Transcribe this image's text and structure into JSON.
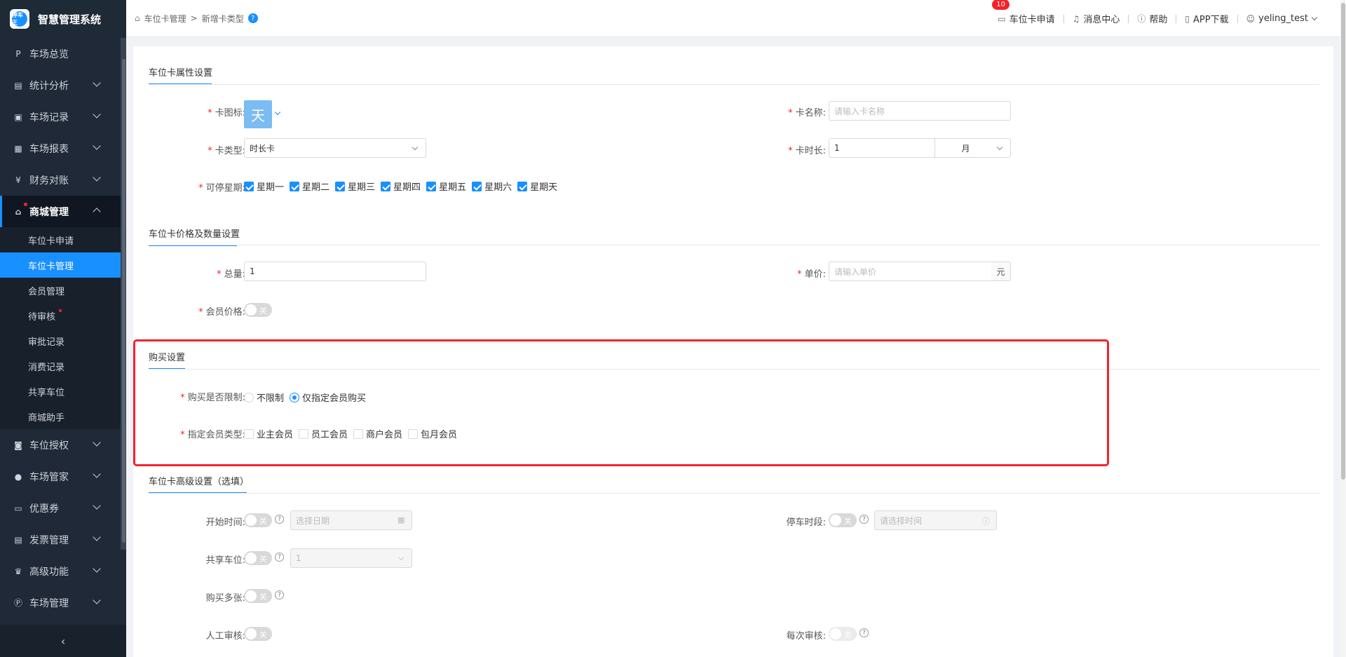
{
  "app": {
    "title": "智慧管理系统",
    "logo_text": "停车王"
  },
  "sidebar": {
    "items": [
      {
        "label": "车场总览",
        "icon": "parking-icon"
      },
      {
        "label": "统计分析",
        "icon": "chart-icon"
      },
      {
        "label": "车场记录",
        "icon": "record-icon"
      },
      {
        "label": "车场报表",
        "icon": "report-icon"
      },
      {
        "label": "财务对账",
        "icon": "finance-icon"
      },
      {
        "label": "商城管理",
        "icon": "shop-icon"
      },
      {
        "label": "车位授权",
        "icon": "car-icon"
      },
      {
        "label": "车场管家",
        "icon": "person-icon"
      },
      {
        "label": "优惠券",
        "icon": "coupon-icon"
      },
      {
        "label": "发票管理",
        "icon": "invoice-icon"
      },
      {
        "label": "高级功能",
        "icon": "crown-icon"
      },
      {
        "label": "车场管理",
        "icon": "park-manage-icon"
      }
    ],
    "subitems": [
      {
        "label": "车位卡申请"
      },
      {
        "label": "车位卡管理"
      },
      {
        "label": "会员管理"
      },
      {
        "label": "待审核"
      },
      {
        "label": "审批记录"
      },
      {
        "label": "消费记录"
      },
      {
        "label": "共享车位"
      },
      {
        "label": "商城助手"
      }
    ],
    "collapse_glyph": "‹"
  },
  "header": {
    "breadcrumb": [
      "车位卡管理",
      ">",
      "新增卡类型"
    ],
    "help_glyph": "?",
    "card_apply_badge": "10",
    "card_apply": "车位卡申请",
    "messages": "消息中心",
    "help": "帮助",
    "app_download": "APP下载",
    "user": "yeling_test"
  },
  "sections": {
    "attr": "车位卡属性设置",
    "price": "车位卡价格及数量设置",
    "purchase": "购买设置",
    "advanced": "车位卡高级设置（选填）"
  },
  "form": {
    "card_icon_label": "卡图标:",
    "card_icon_char": "天",
    "card_name_label": "卡名称:",
    "card_name_placeholder": "请输入卡名称",
    "card_type_label": "卡类型:",
    "card_type_value": "时长卡",
    "card_duration_label": "卡时长:",
    "card_duration_value": "1",
    "card_duration_unit": "月",
    "weekdays_label": "可停星期:",
    "weekdays": [
      "星期一",
      "星期二",
      "星期三",
      "星期四",
      "星期五",
      "星期六",
      "星期天"
    ],
    "total_label": "总量:",
    "total_value": "1",
    "unit_price_label": "单价:",
    "unit_price_placeholder": "请输入单价",
    "unit_price_suffix": "元",
    "member_price_label": "会员价格:",
    "switch_off": "关",
    "purchase_limit_label": "购买是否限制:",
    "purchase_limit_options": [
      "不限制",
      "仅指定会员购买"
    ],
    "member_type_label": "指定会员类型:",
    "member_types": [
      "业主会员",
      "员工会员",
      "商户会员",
      "包月会员"
    ],
    "start_time_label": "开始时间:",
    "start_time_placeholder": "选择日期",
    "parking_period_label": "停车时段:",
    "parking_period_placeholder": "请选择时间",
    "share_space_label": "共享车位:",
    "share_space_value": "1",
    "buy_multiple_label": "购买多张:",
    "manual_review_label": "人工审核:",
    "each_review_label": "每次审核:"
  }
}
